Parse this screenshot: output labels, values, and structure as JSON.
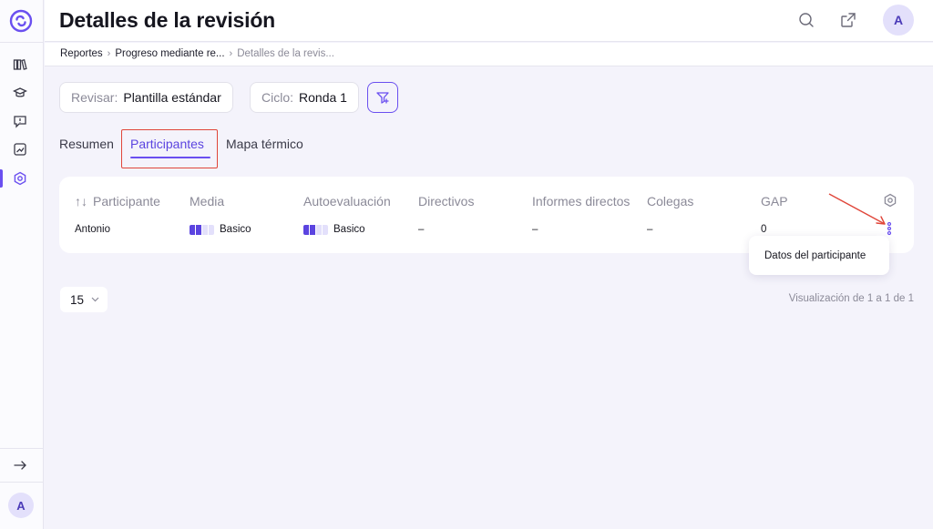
{
  "header": {
    "title": "Detalles de la revisión",
    "avatar_initial": "A"
  },
  "breadcrumb": [
    "Reportes",
    "Progreso mediante re...",
    "Detalles de la revis..."
  ],
  "filters": {
    "review_label": "Revisar:",
    "review_value": "Plantilla estándar",
    "cycle_label": "Ciclo:",
    "cycle_value": "Ronda 1"
  },
  "tabs": [
    {
      "label": "Resumen",
      "active": false
    },
    {
      "label": "Participantes",
      "active": true
    },
    {
      "label": "Mapa térmico",
      "active": false
    }
  ],
  "table": {
    "columns": [
      "Participante",
      "Media",
      "Autoevaluación",
      "Directivos",
      "Informes directos",
      "Colegas",
      "GAP"
    ],
    "rows": [
      {
        "participant": "Antonio",
        "media": {
          "label": "Basico",
          "level": 2,
          "max": 4
        },
        "self": {
          "label": "Basico",
          "level": 2,
          "max": 4
        },
        "directivos": "–",
        "informes": "–",
        "colegas": "–",
        "gap": "0"
      }
    ]
  },
  "row_menu": {
    "item": "Datos del participante"
  },
  "pagination": {
    "page_size": "15",
    "info": "Visualización de 1 a 1 de 1"
  },
  "sidebar": {
    "avatar_initial": "A",
    "icons": [
      "library-icon",
      "graduation-cap-icon",
      "feedback-icon",
      "analytics-icon",
      "settings-icon"
    ]
  },
  "colors": {
    "accent": "#6a4ff0",
    "highlight_box": "#e0463a",
    "background": "#f4f3fb"
  }
}
